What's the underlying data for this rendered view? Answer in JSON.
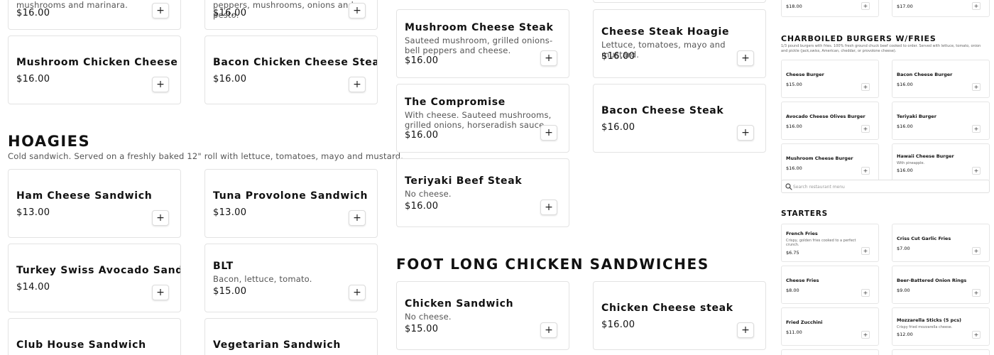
{
  "col1": {
    "top_partial": [
      {
        "desc": "mushrooms and marinara.",
        "price": "$16.00"
      },
      {
        "desc": "peppers, mushrooms, onions and pesto.",
        "price": "$16.00"
      }
    ],
    "cheese_steak_items": [
      {
        "name": "Mushroom Chicken Cheese Steak",
        "price": "$16.00"
      },
      {
        "name": "Bacon Chicken Cheese Steak",
        "price": "$16.00"
      }
    ],
    "hoagies": {
      "title": "HOAGIES",
      "subtitle": "Cold sandwich. Served on a freshly baked 12\" roll with lettuce, tomatoes, mayo and mustard.",
      "items": [
        {
          "name": "Ham Cheese Sandwich",
          "desc": "",
          "price": "$13.00"
        },
        {
          "name": "Tuna Provolone Sandwich",
          "desc": "",
          "price": "$13.00"
        },
        {
          "name": "Turkey Swiss Avocado Sandwich",
          "desc": "",
          "price": "$14.00"
        },
        {
          "name": "BLT",
          "desc": "Bacon, lettuce, tomato.",
          "price": "$15.00"
        },
        {
          "name": "Club House Sandwich",
          "desc": "",
          "price": ""
        },
        {
          "name": "Vegetarian Sandwich",
          "desc": "",
          "price": ""
        }
      ]
    }
  },
  "col2": {
    "items": [
      {
        "name": "Mushroom Cheese Steak",
        "desc": "Sauteed mushroom, grilled onions-bell peppers and cheese.",
        "price": "$16.00"
      },
      {
        "name": "Cheese Steak Hoagie",
        "desc": "Lettuce, tomatoes, mayo and mustard.",
        "price": "$16.00"
      },
      {
        "name": "The Compromise",
        "desc": "With cheese. Sauteed mushrooms, grilled onions, horseradish sauce.",
        "price": "$16.00"
      },
      {
        "name": "Bacon Cheese Steak",
        "desc": "",
        "price": "$16.00"
      },
      {
        "name": "Teriyaki Beef Steak",
        "desc": "No cheese.",
        "price": "$16.00"
      }
    ],
    "chicken": {
      "title": "FOOT LONG CHICKEN SANDWICHES",
      "items": [
        {
          "name": "Chicken Sandwich",
          "desc": "No cheese.",
          "price": "$15.00"
        },
        {
          "name": "Chicken Cheese steak",
          "desc": "",
          "price": "$16.00"
        }
      ]
    }
  },
  "mini": {
    "top_prices": [
      "$18.00",
      "$17.00"
    ],
    "burgers": {
      "title": "CHARBOILED BURGERS W/FRIES",
      "subtitle": "1/3 pound burgers with fries. 100% fresh ground chuck beef cooked to order. Served with lettuce, tomato, onion and pickle (jack,swiss, American, cheddar, or provolone cheese).",
      "items": [
        {
          "name": "Cheese Burger",
          "desc": "",
          "price": "$15.00"
        },
        {
          "name": "Bacon Cheese Burger",
          "desc": "",
          "price": "$16.00"
        },
        {
          "name": "Avocado Cheese Olives Burger",
          "desc": "",
          "price": "$16.00"
        },
        {
          "name": "Teriyaki Burger",
          "desc": "",
          "price": "$16.00"
        },
        {
          "name": "Mushroom Cheese Burger",
          "desc": "",
          "price": "$16.00"
        },
        {
          "name": "Hawaii Cheese Burger",
          "desc": "With pineapple.",
          "price": "$16.00"
        }
      ]
    },
    "search": {
      "placeholder": "Search restaurant menu",
      "value": ""
    },
    "starters": {
      "title": "STARTERS",
      "items": [
        {
          "name": "French Fries",
          "desc": "Crispy, golden fries cooked to a perfect crunch.",
          "price": "$6.75"
        },
        {
          "name": "Criss Cut Garlic Fries",
          "desc": "",
          "price": "$7.00"
        },
        {
          "name": "Cheese Fries",
          "desc": "",
          "price": "$8.00"
        },
        {
          "name": "Beer-Battered Onion Rings",
          "desc": "",
          "price": "$9.00"
        },
        {
          "name": "Fried Zucchini",
          "desc": "",
          "price": "$11.00"
        },
        {
          "name": "Mozzarella Sticks (5 pcs)",
          "desc": "Crispy fried mozzarella cheese.",
          "price": "$12.00"
        }
      ]
    }
  },
  "add_glyph": "+",
  "icons": {
    "add": "plus-icon",
    "search": "search-icon"
  }
}
